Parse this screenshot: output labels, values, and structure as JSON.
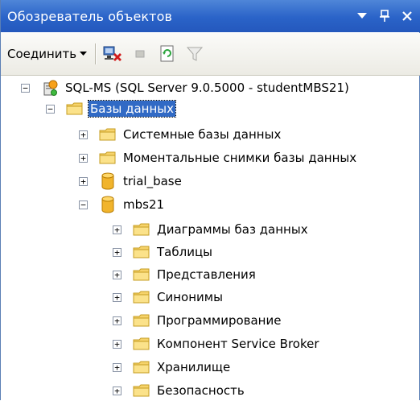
{
  "panel": {
    "title": "Обозреватель объектов"
  },
  "toolbar": {
    "connect_label": "Соединить"
  },
  "tree": {
    "server": "SQL-MS (SQL Server 9.0.5000 - studentMBS21)",
    "databases_folder": "Базы данных",
    "system_dbs": "Системные базы данных",
    "snapshots": "Моментальные снимки базы данных",
    "db_trial": "trial_base",
    "db_mbs21": "mbs21",
    "children": [
      "Диаграммы баз данных",
      "Таблицы",
      "Представления",
      "Синонимы",
      "Программирование",
      "Компонент Service Broker",
      "Хранилище",
      "Безопасность"
    ]
  }
}
